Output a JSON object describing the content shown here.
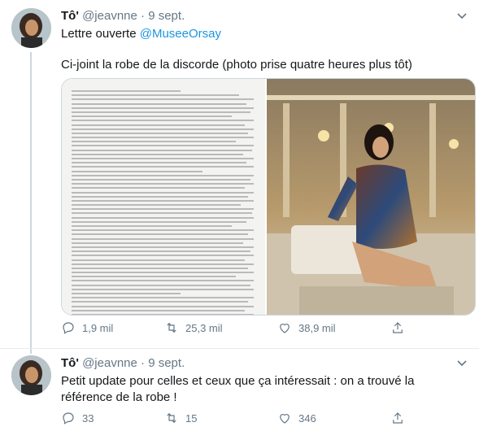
{
  "tweets": [
    {
      "author_name": "Tô'",
      "handle": "@jeavnne",
      "separator": "·",
      "date": "9 sept.",
      "line1_prefix": "Lettre ouverte ",
      "line1_mention": "@MuseeOrsay",
      "line2": "Ci-joint la robe de la discorde (photo prise quatre heures plus tôt)",
      "counts": {
        "replies": "1,9 mil",
        "retweets": "25,3 mil",
        "likes": "38,9 mil"
      }
    },
    {
      "author_name": "Tô'",
      "handle": "@jeavnne",
      "separator": "·",
      "date": "9 sept.",
      "text": "Petit update pour celles et ceux que ça intéressait : on a trouvé la référence de la robe !",
      "counts": {
        "replies": "33",
        "retweets": "15",
        "likes": "346"
      }
    }
  ],
  "icons": [
    "chevron-down-icon",
    "reply-icon",
    "retweet-icon",
    "like-icon",
    "share-icon"
  ],
  "colors": {
    "mention": "#1b95e0",
    "secondary_text": "#657786",
    "divider": "#e6ecf0"
  }
}
